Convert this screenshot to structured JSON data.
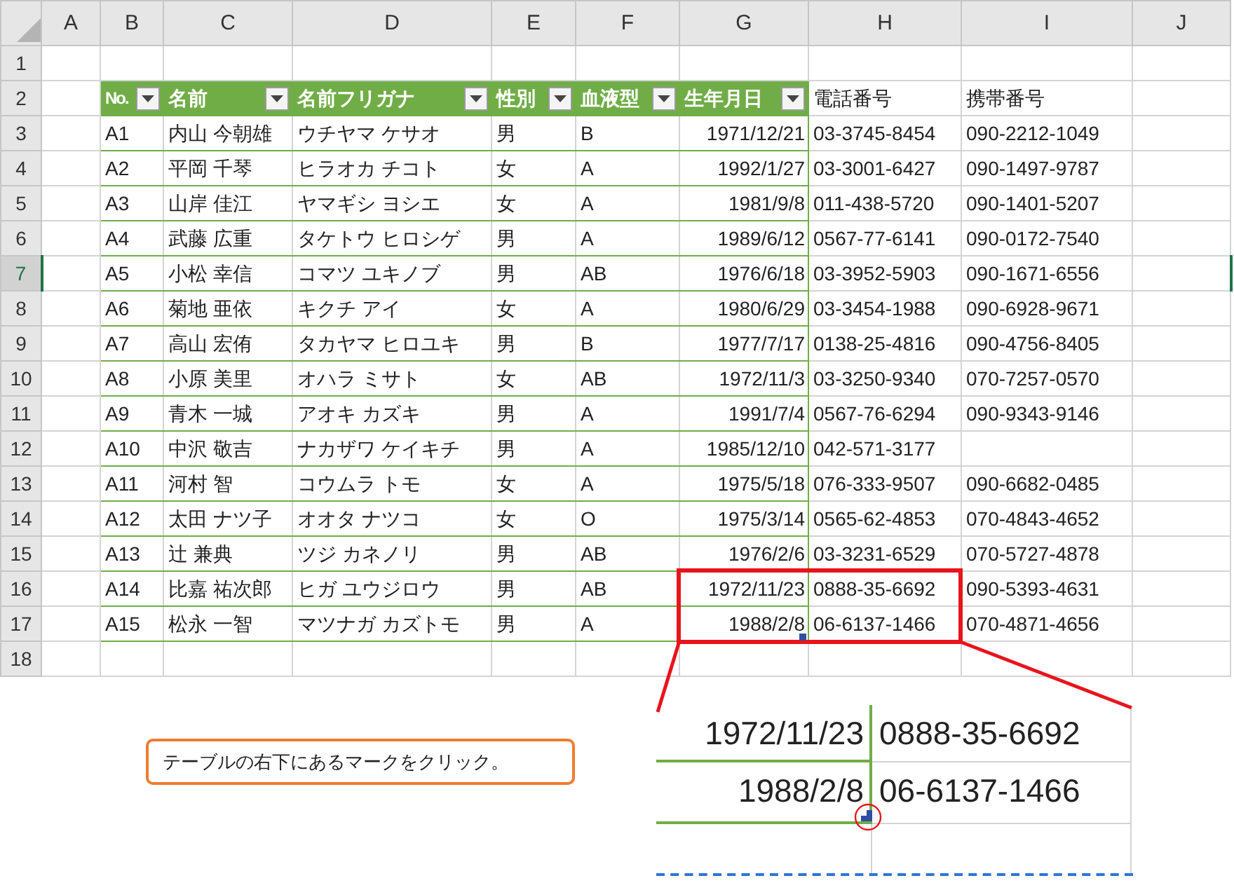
{
  "columns": [
    "A",
    "B",
    "C",
    "D",
    "E",
    "F",
    "G",
    "H",
    "I",
    "J"
  ],
  "rows": [
    {
      "kind": "blank",
      "number": "1",
      "selected": false
    },
    {
      "kind": "heading",
      "number": "2",
      "selected": false,
      "headings": [
        {
          "label": "No.",
          "in_table": true
        },
        {
          "label": "名前",
          "in_table": true
        },
        {
          "label": "名前フリガナ",
          "in_table": true
        },
        {
          "label": "性別",
          "in_table": true
        },
        {
          "label": "血液型",
          "in_table": true
        },
        {
          "label": "生年月日",
          "in_table": true
        },
        {
          "label": "電話番号",
          "in_table": false
        },
        {
          "label": "携帯番号",
          "in_table": false
        }
      ]
    },
    {
      "kind": "record",
      "number": "3",
      "selected": false,
      "no": "A1",
      "name": "内山 今朝雄",
      "kana": "ウチヤマ ケサオ",
      "sex": "男",
      "blood": "B",
      "birth": "1971/12/21",
      "phone": "03-3745-8454",
      "mobile": "090-2212-1049"
    },
    {
      "kind": "record",
      "number": "4",
      "selected": false,
      "no": "A2",
      "name": "平岡 千琴",
      "kana": "ヒラオカ チコト",
      "sex": "女",
      "blood": "A",
      "birth": "1992/1/27",
      "phone": "03-3001-6427",
      "mobile": "090-1497-9787"
    },
    {
      "kind": "record",
      "number": "5",
      "selected": false,
      "no": "A3",
      "name": "山岸 佳江",
      "kana": "ヤマギシ ヨシエ",
      "sex": "女",
      "blood": "A",
      "birth": "1981/9/8",
      "phone": "011-438-5720",
      "mobile": "090-1401-5207"
    },
    {
      "kind": "record",
      "number": "6",
      "selected": false,
      "no": "A4",
      "name": "武藤 広重",
      "kana": "タケトウ ヒロシゲ",
      "sex": "男",
      "blood": "A",
      "birth": "1989/6/12",
      "phone": "0567-77-6141",
      "mobile": "090-0172-7540"
    },
    {
      "kind": "record",
      "number": "7",
      "selected": true,
      "no": "A5",
      "name": "小松 幸信",
      "kana": "コマツ ユキノブ",
      "sex": "男",
      "blood": "AB",
      "birth": "1976/6/18",
      "phone": "03-3952-5903",
      "mobile": "090-1671-6556"
    },
    {
      "kind": "record",
      "number": "8",
      "selected": false,
      "no": "A6",
      "name": "菊地 亜依",
      "kana": "キクチ アイ",
      "sex": "女",
      "blood": "A",
      "birth": "1980/6/29",
      "phone": "03-3454-1988",
      "mobile": "090-6928-9671"
    },
    {
      "kind": "record",
      "number": "9",
      "selected": false,
      "no": "A7",
      "name": "高山 宏侑",
      "kana": "タカヤマ ヒロユキ",
      "sex": "男",
      "blood": "B",
      "birth": "1977/7/17",
      "phone": "0138-25-4816",
      "mobile": "090-4756-8405"
    },
    {
      "kind": "record",
      "number": "10",
      "selected": false,
      "no": "A8",
      "name": "小原 美里",
      "kana": "オハラ ミサト",
      "sex": "女",
      "blood": "AB",
      "birth": "1972/11/3",
      "phone": "03-3250-9340",
      "mobile": "070-7257-0570"
    },
    {
      "kind": "record",
      "number": "11",
      "selected": false,
      "no": "A9",
      "name": "青木 一城",
      "kana": "アオキ カズキ",
      "sex": "男",
      "blood": "A",
      "birth": "1991/7/4",
      "phone": "0567-76-6294",
      "mobile": "090-9343-9146"
    },
    {
      "kind": "record",
      "number": "12",
      "selected": false,
      "no": "A10",
      "name": "中沢 敬吉",
      "kana": "ナカザワ ケイキチ",
      "sex": "男",
      "blood": "A",
      "birth": "1985/12/10",
      "phone": "042-571-3177"
    },
    {
      "kind": "record",
      "number": "13",
      "selected": false,
      "no": "A11",
      "name": "河村 智",
      "kana": "コウムラ トモ",
      "sex": "女",
      "blood": "A",
      "birth": "1975/5/18",
      "phone": "076-333-9507",
      "mobile": "090-6682-0485"
    },
    {
      "kind": "record",
      "number": "14",
      "selected": false,
      "no": "A12",
      "name": "太田 ナツ子",
      "kana": "オオタ ナツコ",
      "sex": "女",
      "blood": "O",
      "birth": "1975/3/14",
      "phone": "0565-62-4853",
      "mobile": "070-4843-4652"
    },
    {
      "kind": "record",
      "number": "15",
      "selected": false,
      "no": "A13",
      "name": "辻 兼典",
      "kana": "ツジ カネノリ",
      "sex": "男",
      "blood": "AB",
      "birth": "1976/2/6",
      "phone": "03-3231-6529",
      "mobile": "070-5727-4878"
    },
    {
      "kind": "record",
      "number": "16",
      "selected": false,
      "no": "A14",
      "name": "比嘉 祐次郎",
      "kana": "ヒガ ユウジロウ",
      "sex": "男",
      "blood": "AB",
      "birth": "1972/11/23",
      "phone": "0888-35-6692",
      "mobile": "090-5393-4631"
    },
    {
      "kind": "record",
      "number": "17",
      "selected": false,
      "no": "A15",
      "name": "松永 一智",
      "kana": "マツナガ カズトモ",
      "sex": "男",
      "blood": "A",
      "birth": "1988/2/8",
      "phone": "06-6137-1466",
      "mobile": "070-4871-4656"
    },
    {
      "kind": "blank",
      "number": "18",
      "selected": false
    }
  ],
  "callout": {
    "text": "テーブルの右下にあるマークをクリック。"
  },
  "zoom_inset": {
    "rows": [
      {
        "birth": "1972/11/23",
        "phone": "0888-35-6692"
      },
      {
        "birth": "1988/2/8",
        "phone": "06-6137-1466"
      }
    ]
  }
}
